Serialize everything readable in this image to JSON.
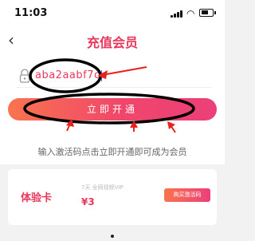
{
  "status": {
    "time": "11:03"
  },
  "nav": {
    "back_icon": "chevron-left-icon",
    "title": "充值会员"
  },
  "activation": {
    "lock_icon": "lock-icon",
    "code_value": "aba2aabf7c"
  },
  "submit_label": "立即开通",
  "hint": "输入激活码点击立即开通即可成为会员",
  "card": {
    "name": "体验卡",
    "subtitle": "7天 全网视频VIP",
    "price": "¥3",
    "buy_label": "购买激活码"
  },
  "colors": {
    "accent": "#e8385c",
    "annotation": "#e8211e"
  }
}
